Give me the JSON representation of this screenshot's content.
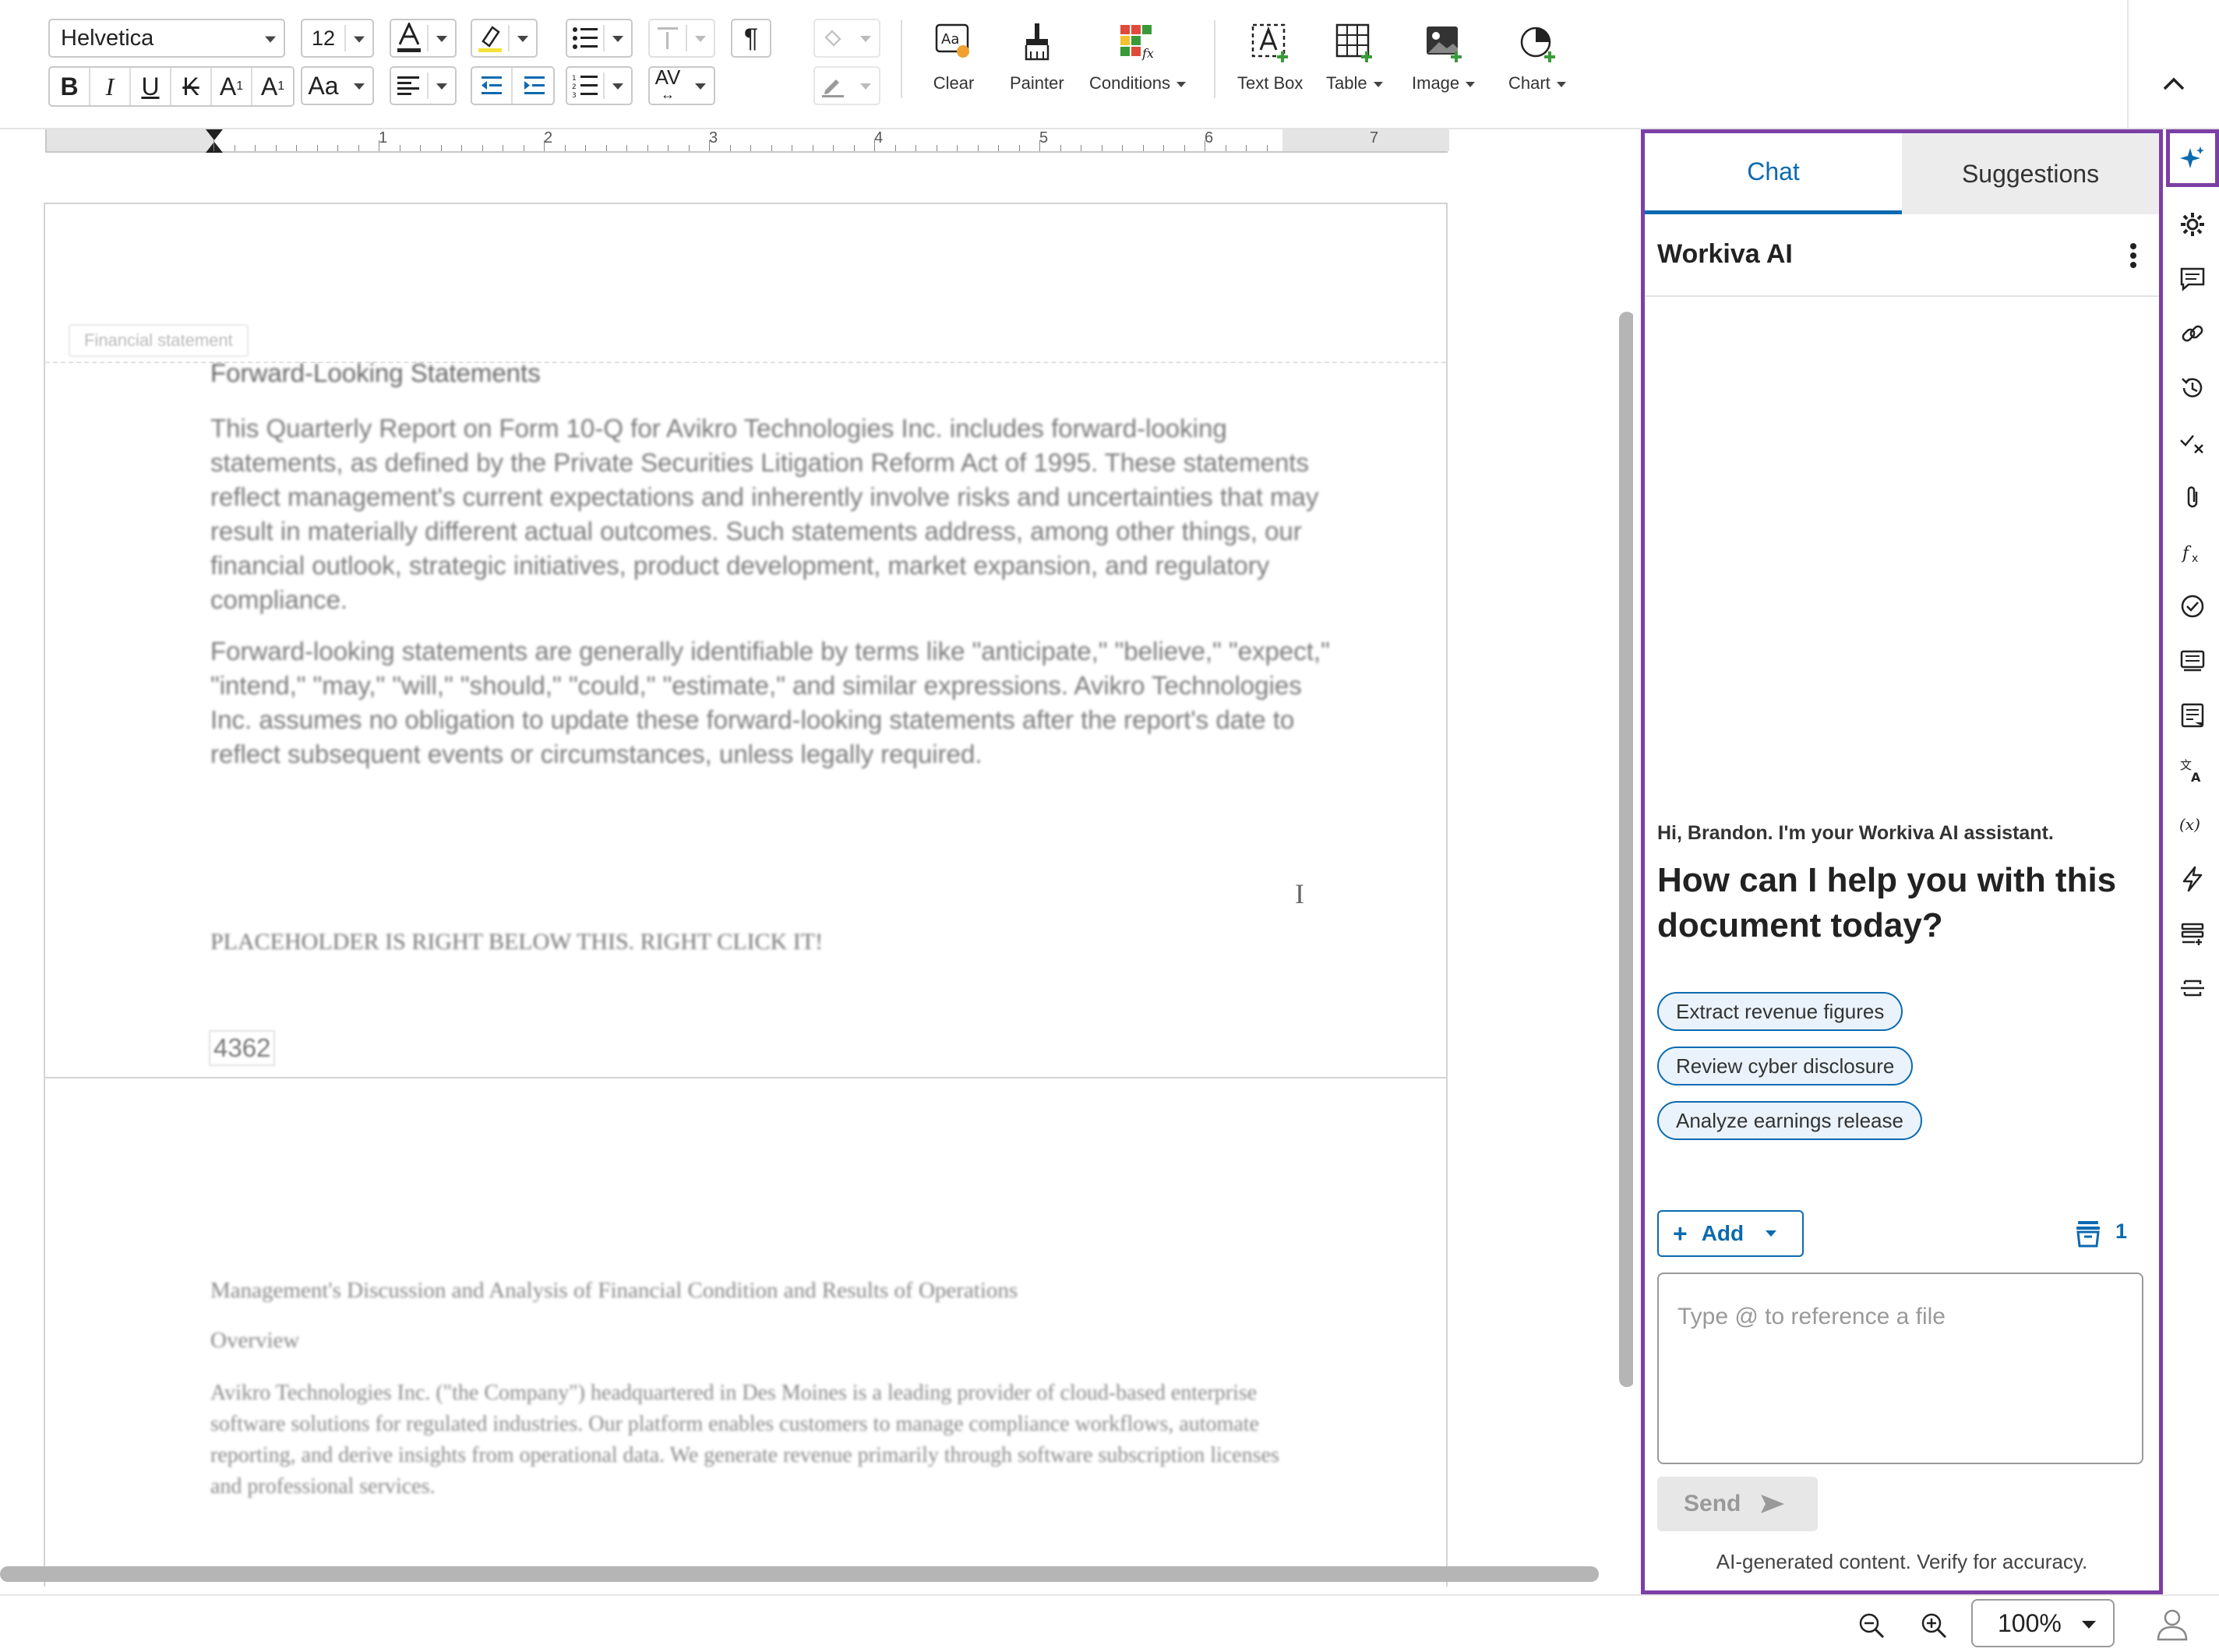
{
  "toolbar": {
    "font_name": "Helvetica",
    "font_size": "12",
    "format_buttons": [
      "B",
      "I",
      "U",
      "K",
      "A",
      "A"
    ],
    "case_label": "Aa",
    "pilcrow": "¶",
    "kerning_label": "AV",
    "big_buttons": {
      "clear": "Clear",
      "painter": "Painter",
      "conditions": "Conditions",
      "text_box": "Text Box",
      "table": "Table",
      "image": "Image",
      "chart": "Chart"
    }
  },
  "ruler": {
    "numbers": [
      "1",
      "2",
      "3",
      "4",
      "5",
      "6",
      "7"
    ]
  },
  "document": {
    "section_tag": "Financial statement",
    "heading": "Forward-Looking Statements",
    "para1": "This Quarterly Report on Form 10-Q for Avikro Technologies Inc. includes forward-looking statements, as defined by the Private Securities Litigation Reform Act of 1995. These statements reflect management's current expectations and inherently involve risks and uncertainties that may result in materially different actual outcomes. Such statements address, among other things, our financial outlook, strategic initiatives, product development, market expansion, and regulatory compliance.",
    "para2": "Forward-looking statements are generally identifiable by terms like \"anticipate,\" \"believe,\" \"expect,\" \"intend,\" \"may,\" \"will,\" \"should,\" \"could,\" \"estimate,\" and similar expressions. Avikro Technologies Inc. assumes no obligation to update these forward-looking statements after the report's date to reflect subsequent events or circumstances, unless legally required.",
    "placeholder_note": "PLACEHOLDER IS RIGHT BELOW THIS. RIGHT CLICK IT!",
    "placeholder_value": "4362",
    "page2_heading": "Management's Discussion and Analysis of Financial Condition and Results of Operations",
    "page2_subheading": "Overview",
    "page2_para": "Avikro Technologies Inc. (\"the Company\") headquartered in Des Moines is a leading provider of cloud-based enterprise software solutions for regulated industries. Our platform enables customers to manage compliance workflows, automate reporting, and derive insights from operational data. We generate revenue primarily through software subscription licenses and professional services."
  },
  "ai_panel": {
    "tabs": [
      "Chat",
      "Suggestions"
    ],
    "title": "Workiva AI",
    "greeting": "Hi, Brandon. I'm your Workiva AI assistant.",
    "question": "How can I help you with this document today?",
    "chips": [
      "Extract revenue figures",
      "Review cyber disclosure",
      "Analyze earnings release"
    ],
    "add_label": "Add",
    "file_count": "1",
    "input_placeholder": "Type @ to reference a file",
    "send_label": "Send",
    "disclaimer": "AI-generated content. Verify for accuracy."
  },
  "rail_icons": [
    "ai-sparkle-icon",
    "gear-icon",
    "comment-icon",
    "link-icon",
    "history-icon",
    "check-x-icon",
    "attachment-icon",
    "formula-icon",
    "task-check-icon",
    "comments-list-icon",
    "notes-icon",
    "translate-icon",
    "variable-icon",
    "lightning-icon",
    "list-add-icon",
    "strikethrough-icon"
  ],
  "status": {
    "zoom": "100%"
  },
  "colors": {
    "accent_blue": "#0b6ab0",
    "ai_purple": "#7b3fa6"
  }
}
